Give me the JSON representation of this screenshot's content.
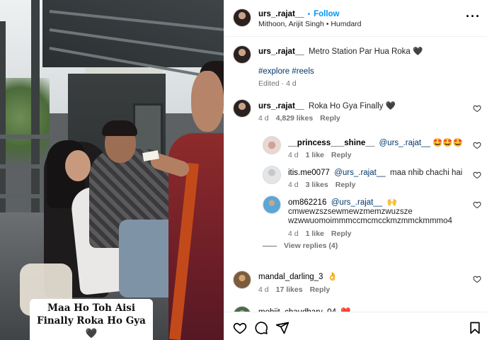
{
  "media": {
    "caption": "Maa Ho Toh Aisi Finally Roka Ho Gya 🖤"
  },
  "header": {
    "username": "urs_.rajat__",
    "follow_label": "Follow",
    "dot": "•",
    "music": "Mithoon, Arijit Singh",
    "song": "Humdard",
    "more_icon": "more-horizontal-icon"
  },
  "post": {
    "username": "urs_.rajat__",
    "caption": "Metro Station Par Hua Roka 🖤",
    "hashtags": "#explore #reels",
    "edited": "Edited · 4 d"
  },
  "comments": [
    {
      "username": "urs_.rajat__",
      "text": "Roka Ho Gya Finally 🖤",
      "time": "4 d",
      "likes": "4,829 likes",
      "reply": "Reply"
    },
    {
      "username": "__princess___shine__",
      "mention": "@urs_.rajat__",
      "text": "🤩🤩🤩",
      "time": "4 d",
      "likes": "1 like",
      "reply": "Reply"
    },
    {
      "username": "itis.me0077",
      "mention": "@urs_.rajat__",
      "text": "maa nhib chachi hai",
      "time": "4 d",
      "likes": "3 likes",
      "reply": "Reply"
    },
    {
      "username": "om862216",
      "mention": "@urs_.rajat__",
      "text": "🙌",
      "text_line2": "cmwewzszsewmewzmemzwuzsze",
      "text_line3": "wzwwuomoimmmccmcmcckmzmmckmmmo4",
      "time": "4 d",
      "likes": "1 like",
      "reply": "Reply"
    },
    {
      "view_replies": "View replies (4)"
    },
    {
      "username": "mandal_darling_3",
      "text": "👌",
      "time": "4 d",
      "likes": "17 likes",
      "reply": "Reply"
    },
    {
      "username": "mohiit_chaudhary_04",
      "text": "❤️"
    }
  ],
  "footer": {
    "icons": [
      "heart-icon",
      "comment-icon",
      "share-icon",
      "bookmark-icon"
    ]
  },
  "colors": {
    "link_blue": "#0095f6",
    "mention_blue": "#00376b",
    "muted": "#737373",
    "border": "#efefef"
  }
}
